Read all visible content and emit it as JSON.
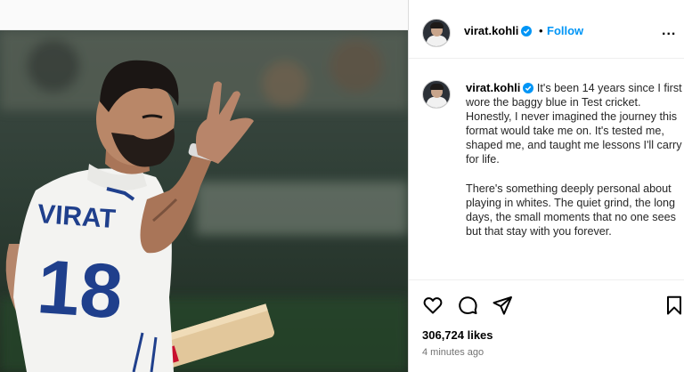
{
  "post": {
    "username": "virat.kohli",
    "dot": "•",
    "follow_label": "Follow",
    "more_label": "...",
    "caption": {
      "username": "virat.kohli",
      "paragraph1": "It's been 14 years since I first wore the baggy blue in Test cricket. Honestly, I never imagined the journey this format would take me on. It's tested me, shaped me, and taught me lessons I'll carry for life.",
      "paragraph2": "There's something deeply personal about playing in whites. The quiet grind, the long days, the small moments that no one sees but that stay with you forever."
    },
    "likes": "306,724 likes",
    "time": "4 minutes ago",
    "photo": {
      "jersey_name": "VIRAT",
      "jersey_number": "18"
    }
  },
  "colors": {
    "follow_blue": "#0095f6",
    "verified_blue": "#0095f6",
    "jersey_navy": "#1f3f8c"
  },
  "icons": [
    "heart-icon",
    "comment-icon",
    "share-icon",
    "bookmark-icon",
    "verified-icon",
    "more-icon"
  ]
}
